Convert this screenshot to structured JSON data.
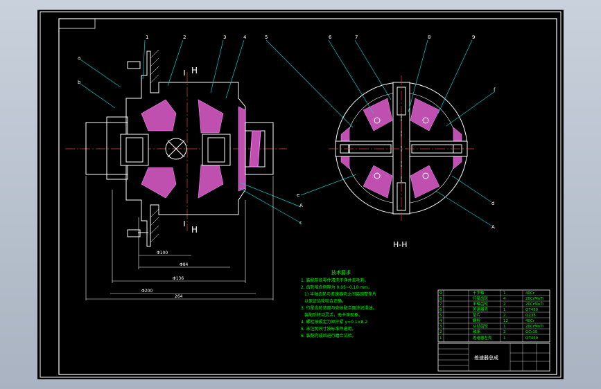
{
  "drawing": {
    "section_label_main": "H",
    "section_label_main_bottom": "H",
    "section_view_title": "H-H",
    "part_balloons_left": [
      "1",
      "2",
      "3",
      "4",
      "5"
    ],
    "part_balloons_right": [
      "6",
      "7",
      "8",
      "9",
      "f"
    ],
    "side_labels_left": [
      "a",
      "b"
    ],
    "side_labels_right_lower": [
      "A",
      "c"
    ],
    "side_labels_right_view": [
      "e",
      "d",
      "A"
    ],
    "dimensions": [
      "Φ100",
      "Φ84",
      "Φ136",
      "Φ200",
      "264"
    ]
  },
  "notes": {
    "title": "技术要求",
    "lines": [
      "1. 装配前各零件清洗干净并去毛刺。",
      "2. 齿轮啮合侧隙为 0.05~0.10 mm。",
      "  1) 半轴齿轮与差速器壳之间装调整垫片",
      "  以保证齿轮啮合正确。",
      "3. 行星齿轮背面与壳体配合面涂润滑油。",
      "  装配后转动灵活，无卡滞现象。",
      "4. 螺栓按规定力矩拧紧 y=0.1×8.2",
      "5. 未注明尺寸按标准件选用。",
      "6. 装配完成后进行磨合试验。"
    ]
  },
  "title_block": {
    "drawing_name": "差速器总成",
    "rows": [
      [
        "9",
        "十字轴",
        "1",
        "40Cr"
      ],
      [
        "8",
        "行星齿轮",
        "4",
        "20CrMnTi"
      ],
      [
        "7",
        "半轴齿轮",
        "2",
        "20CrMnTi"
      ],
      [
        "6",
        "差速器壳",
        "1",
        "QT450"
      ],
      [
        "5",
        "垫片",
        "2",
        "Q235"
      ],
      [
        "4",
        "螺栓",
        "12",
        "40Cr"
      ],
      [
        "3",
        "从动齿轮",
        "1",
        "20CrMnTi"
      ],
      [
        "2",
        "轴承",
        "2",
        "GCr15"
      ],
      [
        "1",
        "差速器左壳",
        "1",
        "QT450"
      ]
    ]
  }
}
